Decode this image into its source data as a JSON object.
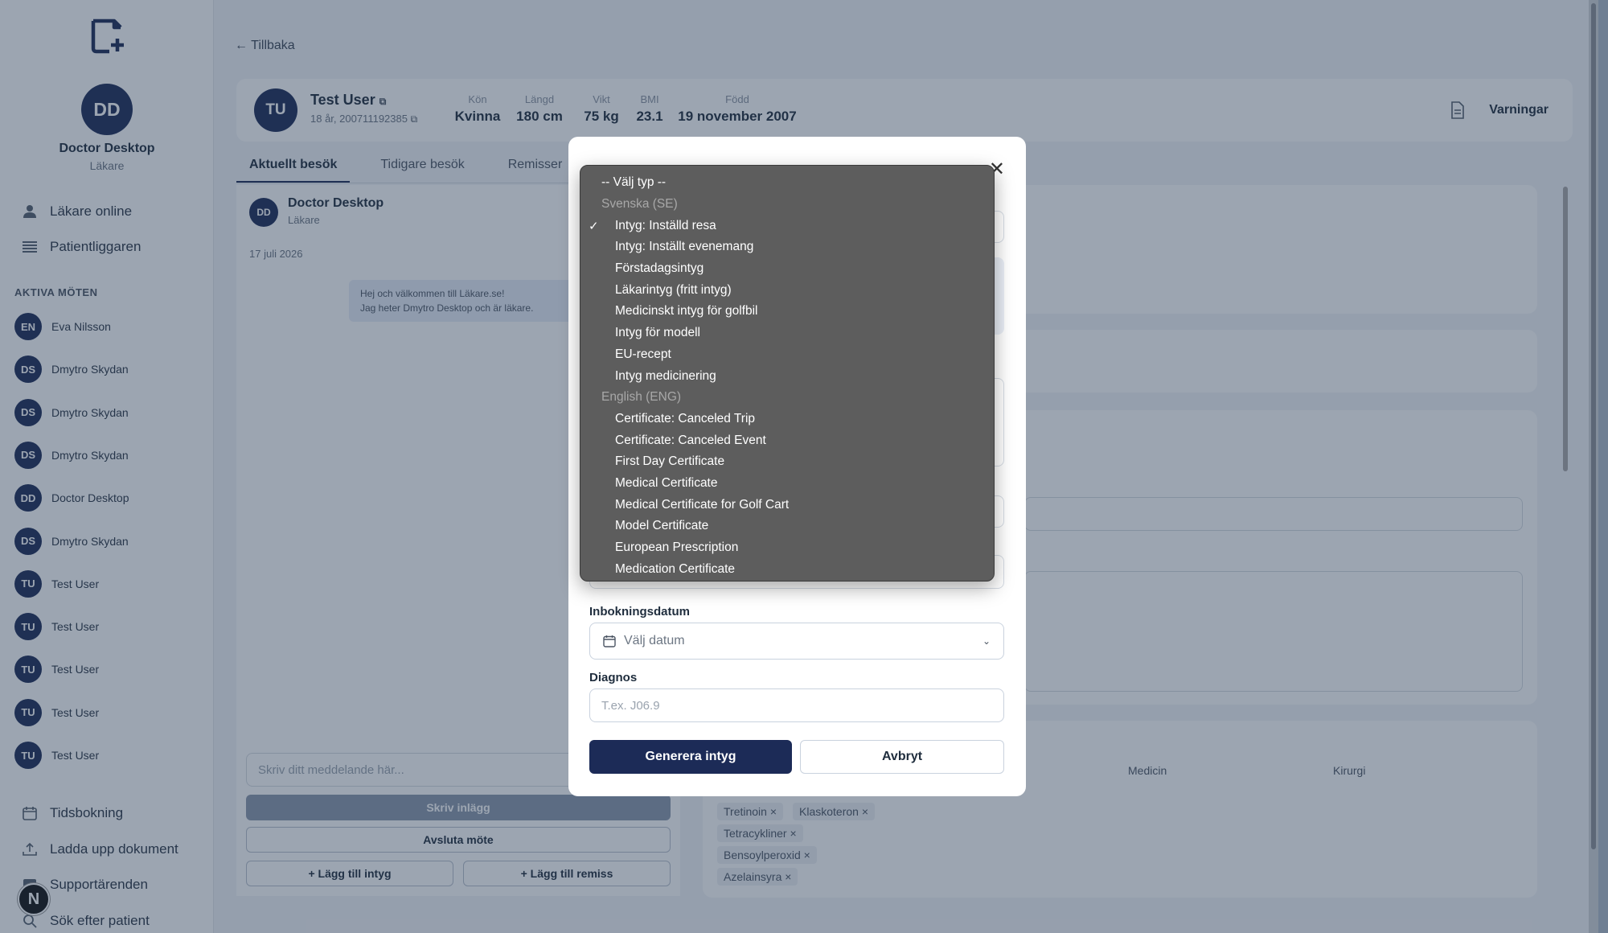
{
  "back_label": "← Tillbaka",
  "doctor": {
    "initials": "DD",
    "name": "Doctor Desktop",
    "role": "Läkare"
  },
  "sidebar": {
    "nav_top": [
      {
        "label": "Läkare online",
        "icon": "person-icon"
      },
      {
        "label": "Patientliggaren",
        "icon": "list-icon"
      }
    ],
    "active_meetings_title": "AKTIVA MÖTEN",
    "meetings": [
      {
        "initials": "EN",
        "name": "Eva Nilsson"
      },
      {
        "initials": "DS",
        "name": "Dmytro Skydan"
      },
      {
        "initials": "DS",
        "name": "Dmytro Skydan"
      },
      {
        "initials": "DS",
        "name": "Dmytro Skydan"
      },
      {
        "initials": "DD",
        "name": "Doctor Desktop"
      },
      {
        "initials": "DS",
        "name": "Dmytro Skydan"
      },
      {
        "initials": "TU",
        "name": "Test User"
      },
      {
        "initials": "TU",
        "name": "Test User"
      },
      {
        "initials": "TU",
        "name": "Test User"
      },
      {
        "initials": "TU",
        "name": "Test User"
      },
      {
        "initials": "TU",
        "name": "Test User"
      }
    ],
    "nav_bottom": [
      {
        "label": "Tidsbokning",
        "icon": "calendar-icon"
      },
      {
        "label": "Ladda upp dokument",
        "icon": "upload-icon"
      },
      {
        "label": "Supportärenden",
        "icon": "support-icon"
      },
      {
        "label": "Sök efter patient",
        "icon": "search-icon"
      }
    ],
    "badge": "N"
  },
  "patient": {
    "initials": "TU",
    "name": "Test User",
    "sub": "18 år, 200711192385",
    "stats": [
      {
        "label": "Kön",
        "value": "Kvinna"
      },
      {
        "label": "Längd",
        "value": "180 cm"
      },
      {
        "label": "Vikt",
        "value": "75 kg"
      },
      {
        "label": "BMI",
        "value": "23.1"
      },
      {
        "label": "Född",
        "value": "19 november 2007"
      }
    ],
    "warnings_label": "Varningar"
  },
  "tabs": [
    "Aktuellt besök",
    "Tidigare besök",
    "Remisser"
  ],
  "chat": {
    "sender": "Doctor Desktop",
    "sender_initials": "DD",
    "sender_role": "Läkare",
    "date": "17 juli 2026",
    "message_line1": "Hej och välkommen till Läkare.se!",
    "message_line2": "Jag heter Dmytro Desktop och är läkare.",
    "input_placeholder": "Skriv ditt meddelande här...",
    "write_btn": "Skriv inlägg",
    "end_btn": "Avsluta möte",
    "add_cert_btn": "+ Lägg till intyg",
    "add_referral_btn": "+ Lägg till remiss"
  },
  "right_panel": {
    "columns": [
      "Medicin",
      "Kirurgi"
    ],
    "chips": [
      "Tretinoin ×",
      "Klaskoteron ×",
      "Tetracykliner ×",
      "Bensoylperoxid ×",
      "Azelainsyra ×"
    ]
  },
  "modal": {
    "booking_label": "Inbokningsdatum",
    "date_placeholder": "Välj datum",
    "diagnosis_label": "Diagnos",
    "diagnosis_placeholder": "T.ex. J06.9",
    "generate_btn": "Generera intyg",
    "cancel_btn": "Avbryt"
  },
  "dropdown": {
    "placeholder": "-- Välj typ --",
    "groups": [
      {
        "label": "Svenska (SE)",
        "options": [
          "Intyg: Inställd resa",
          "Intyg: Inställt evenemang",
          "Förstadagsintyg",
          "Läkarintyg (fritt intyg)",
          "Medicinskt intyg för golfbil",
          "Intyg för modell",
          "EU-recept",
          "Intyg medicinering"
        ]
      },
      {
        "label": "English (ENG)",
        "options": [
          "Certificate: Canceled Trip",
          "Certificate: Canceled Event",
          "First Day Certificate",
          "Medical Certificate",
          "Medical Certificate for Golf Cart",
          "Model Certificate",
          "European Prescription",
          "Medication Certificate"
        ]
      }
    ],
    "selected": "Intyg: Inställd resa"
  }
}
